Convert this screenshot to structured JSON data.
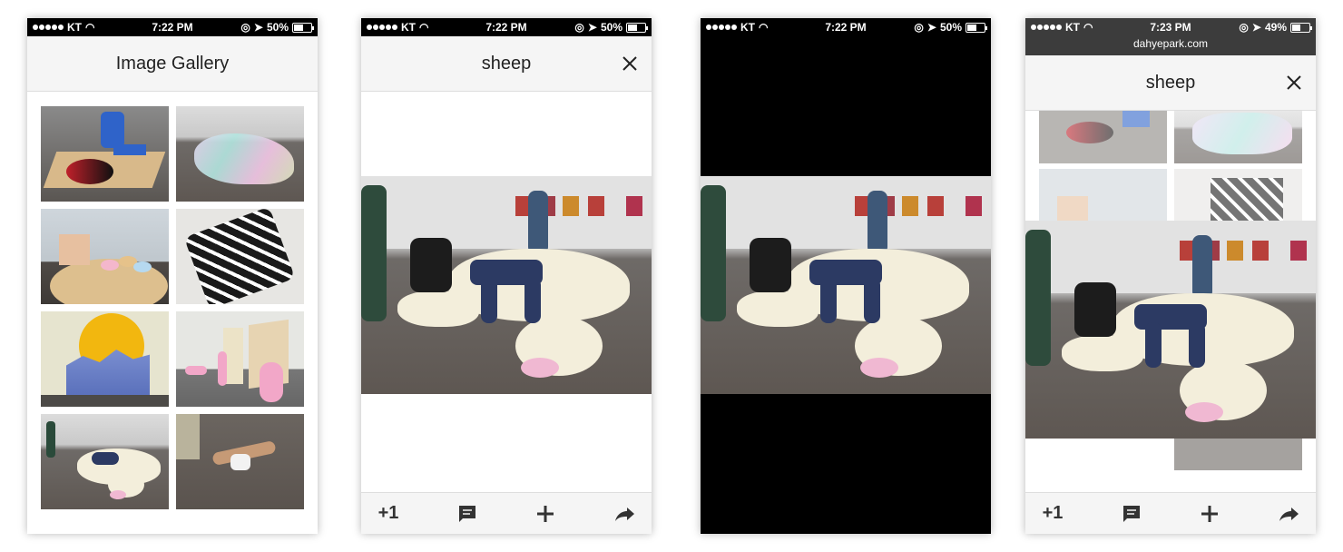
{
  "status": {
    "carrier": "KT",
    "screen1_time": "7:22 PM",
    "screen2_time": "7:22 PM",
    "screen3_time": "7:22 PM",
    "screen4_time": "7:23 PM",
    "battery_50": "50%",
    "battery_49": "49%",
    "url": "dahyepark.com"
  },
  "gallery": {
    "title": "Image Gallery",
    "thumbnails": [
      "blue-sculpture",
      "iridescent-sheet",
      "donuts-table",
      "zigzag-sculpture",
      "sun-mountain",
      "pink-figures",
      "sheep",
      "person-floor"
    ]
  },
  "viewer": {
    "title": "sheep"
  },
  "toolbar": {
    "plus_one": "+1",
    "comment_icon": "comment-icon",
    "add_icon": "add-icon",
    "share_icon": "share-icon"
  },
  "colors": {
    "bar_bg": "#f5f5f5",
    "status_bg": "#000000",
    "status_bg_browser": "#3c3c3c"
  }
}
